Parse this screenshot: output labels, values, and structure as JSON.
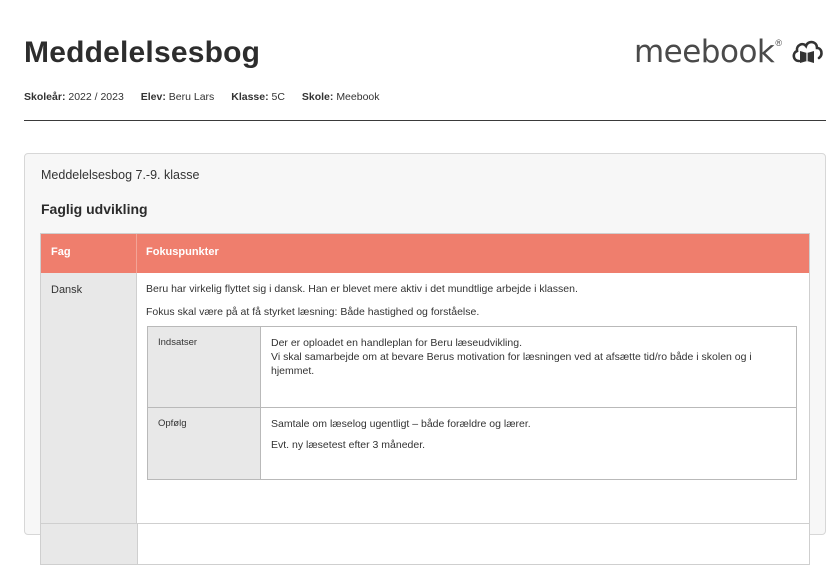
{
  "header": {
    "title": "Meddelelsesbog",
    "logo_text": "meebook",
    "logo_reg": "®",
    "meta": [
      {
        "label": "Skoleår:",
        "value": "2022 / 2023"
      },
      {
        "label": "Elev:",
        "value": "Beru Lars"
      },
      {
        "label": "Klasse:",
        "value": "5C"
      },
      {
        "label": "Skole:",
        "value": "Meebook"
      }
    ]
  },
  "card": {
    "title": "Meddelelsesbog 7.-9. klasse",
    "section_title": "Faglig udvikling",
    "table": {
      "headers": [
        "Fag",
        "Fokuspunkter"
      ],
      "rows": [
        {
          "subject": "Dansk",
          "paragraphs": [
            "Beru har virkelig flyttet sig i dansk. Han er blevet mere aktiv i det mundtlige arbejde i klassen.",
            "Fokus skal være på at få styrket læsning: Både hastighed og forståelse."
          ],
          "inner": [
            {
              "label": "Indsatser",
              "lines": [
                "Der er oploadet en handleplan for Beru læseudvikling.",
                "Vi skal samarbejde om at bevare Berus motivation for læsningen ved at afsætte tid/ro både i skolen og i hjemmet."
              ]
            },
            {
              "label": "Opfølg",
              "lines": [
                "Samtale om læselog ugentligt – både forældre og lærer.",
                "Evt. ny læsetest efter 3 måneder."
              ]
            }
          ]
        }
      ]
    }
  },
  "colors": {
    "header_accent": "#ef7e6d",
    "label_column": "#e8e8e8",
    "card_background": "#f7f7f7"
  },
  "icons": [
    "meebook-book-cloud-icon"
  ]
}
